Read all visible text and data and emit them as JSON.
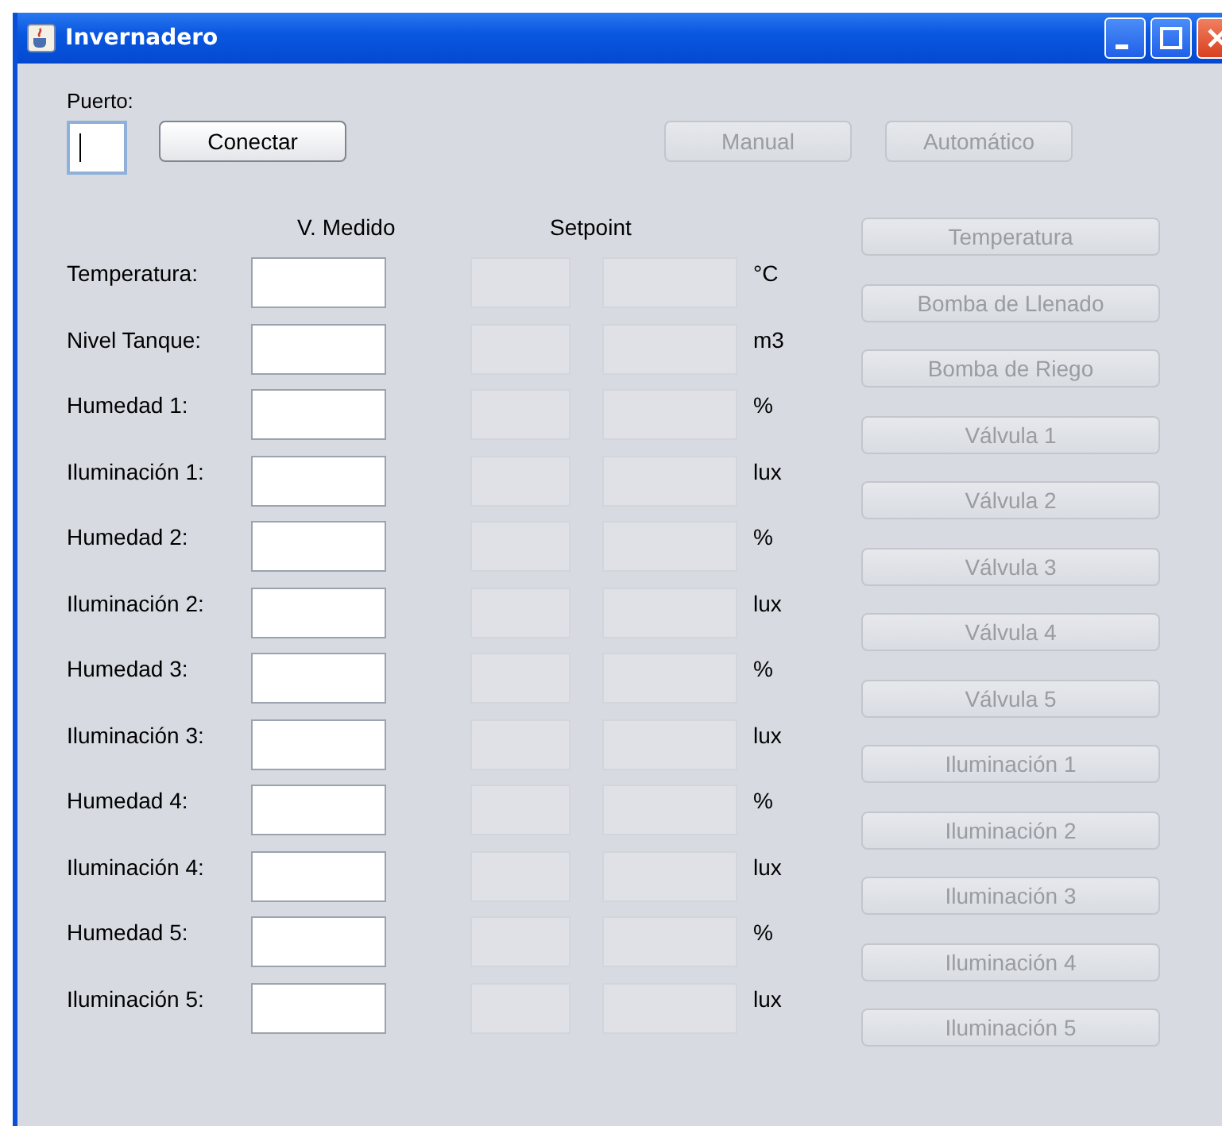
{
  "window": {
    "title": "Invernadero"
  },
  "port": {
    "label": "Puerto:",
    "focused": true
  },
  "top_buttons": [
    {
      "label": "Conectar",
      "disabled": false
    },
    {
      "label": "Manual",
      "disabled": true
    },
    {
      "label": "Automático",
      "disabled": true
    }
  ],
  "table": {
    "columns": [
      "V. Medido",
      "Setpoint"
    ],
    "rows": [
      {
        "label": "Temperatura:",
        "unit": "°C"
      },
      {
        "label": "Nivel Tanque:",
        "unit": "m3"
      },
      {
        "label": "Humedad 1:",
        "unit": "%"
      },
      {
        "label": "Iluminación 1:",
        "unit": "lux"
      },
      {
        "label": "Humedad 2:",
        "unit": "%"
      },
      {
        "label": "Iluminación 2:",
        "unit": "lux"
      },
      {
        "label": "Humedad 3:",
        "unit": "%"
      },
      {
        "label": "Iluminación 3:",
        "unit": "lux"
      },
      {
        "label": "Humedad 4:",
        "unit": "%"
      },
      {
        "label": "Iluminación 4:",
        "unit": "lux"
      },
      {
        "label": "Humedad 5:",
        "unit": "%"
      },
      {
        "label": "Iluminación 5:",
        "unit": "lux"
      }
    ]
  },
  "side_buttons": [
    {
      "label": "Temperatura",
      "disabled": true
    },
    {
      "label": "Bomba de Llenado",
      "disabled": true
    },
    {
      "label": "Bomba de Riego",
      "disabled": true
    },
    {
      "label": "Válvula  1",
      "disabled": true
    },
    {
      "label": "Válvula 2",
      "disabled": true
    },
    {
      "label": "Válvula 3",
      "disabled": true
    },
    {
      "label": "Válvula 4",
      "disabled": true
    },
    {
      "label": "Válvula 5",
      "disabled": true
    },
    {
      "label": "Iluminación 1",
      "disabled": true
    },
    {
      "label": "Iluminación 2",
      "disabled": true
    },
    {
      "label": "Iluminación 3",
      "disabled": true
    },
    {
      "label": "Iluminación 4",
      "disabled": true
    },
    {
      "label": "Iluminación 5",
      "disabled": true
    }
  ]
}
